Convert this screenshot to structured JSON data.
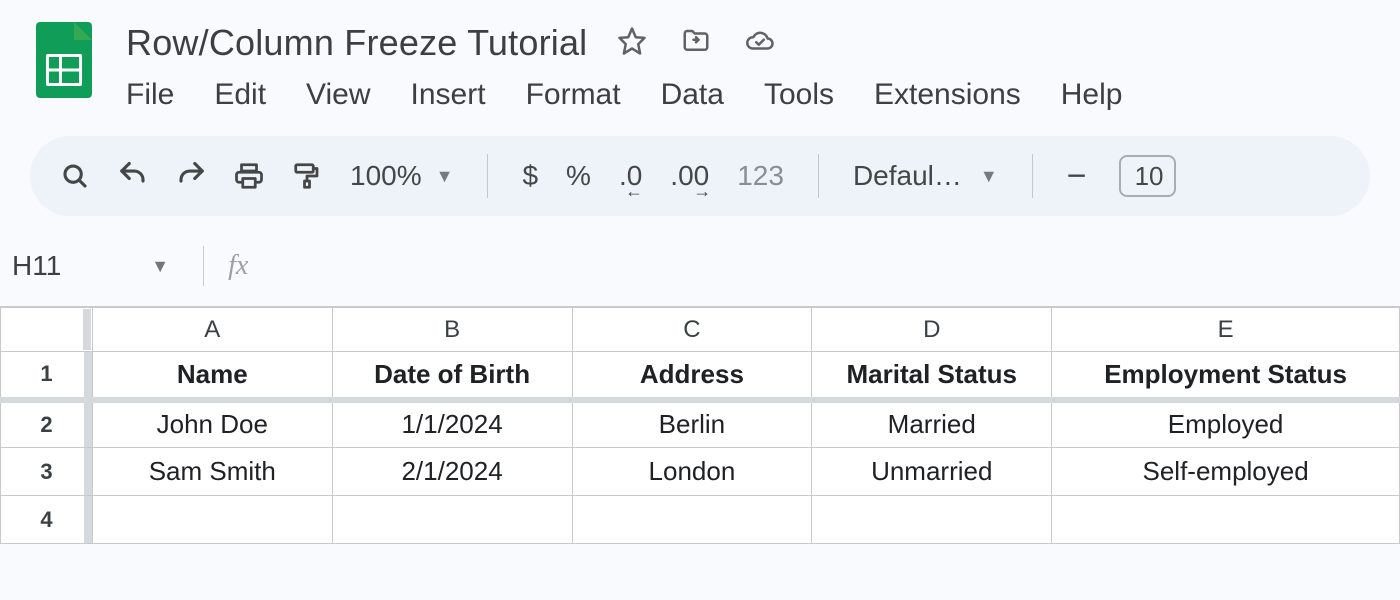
{
  "doc": {
    "title": "Row/Column Freeze Tutorial"
  },
  "menubar": {
    "items": [
      "File",
      "Edit",
      "View",
      "Insert",
      "Format",
      "Data",
      "Tools",
      "Extensions",
      "Help"
    ]
  },
  "toolbar": {
    "zoom": "100%",
    "currency": "$",
    "percent": "%",
    "dec_decrease": ".0",
    "dec_increase": ".00",
    "more_formats": "123",
    "font": "Defaul…",
    "minus": "−",
    "font_size": "10"
  },
  "name_box": {
    "cell": "H11",
    "fx_label": "fx"
  },
  "sheet": {
    "columns": [
      "A",
      "B",
      "C",
      "D",
      "E"
    ],
    "row_numbers": [
      "1",
      "2",
      "3",
      "4"
    ],
    "headers": [
      "Name",
      "Date of Birth",
      "Address",
      "Marital Status",
      "Employment Status"
    ],
    "rows": [
      [
        "John Doe",
        "1/1/2024",
        "Berlin",
        "Married",
        "Employed"
      ],
      [
        "Sam Smith",
        "2/1/2024",
        "London",
        "Unmarried",
        "Self-employed"
      ]
    ]
  }
}
